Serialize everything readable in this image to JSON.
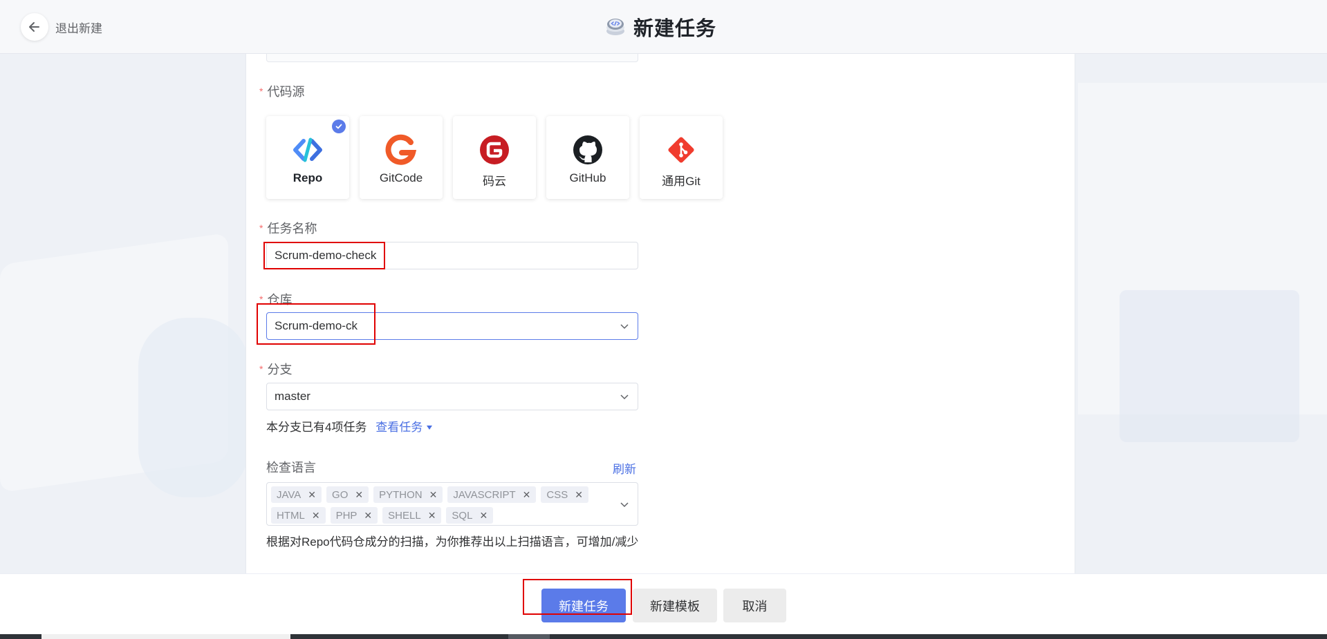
{
  "header": {
    "back_label": "退出新建",
    "title": "新建任务"
  },
  "form": {
    "source_label": "代码源",
    "sources": [
      {
        "name": "Repo",
        "icon": "repo-icon",
        "selected": true
      },
      {
        "name": "GitCode",
        "icon": "gitcode-icon",
        "selected": false
      },
      {
        "name": "码云",
        "icon": "gitee-icon",
        "selected": false
      },
      {
        "name": "GitHub",
        "icon": "github-icon",
        "selected": false
      },
      {
        "name": "通用Git",
        "icon": "git-icon",
        "selected": false
      }
    ],
    "task_name_label": "任务名称",
    "task_name_value": "Scrum-demo-check",
    "repo_label": "仓库",
    "repo_value": "Scrum-demo-ck",
    "branch_label": "分支",
    "branch_value": "master",
    "branch_hint": "本分支已有4项任务",
    "view_tasks_link": "查看任务",
    "language_label": "检查语言",
    "refresh_link": "刷新",
    "languages": [
      "JAVA",
      "GO",
      "PYTHON",
      "JAVASCRIPT",
      "CSS",
      "HTML",
      "PHP",
      "SHELL",
      "SQL"
    ],
    "language_hint": "根据对Repo代码仓成分的扫描，为你推荐出以上扫描语言，可增加/减少"
  },
  "footer": {
    "create_task": "新建任务",
    "create_template": "新建模板",
    "cancel": "取消"
  },
  "colors": {
    "primary": "#5b7be9",
    "link": "#4a6fe3",
    "required": "#f56c6c",
    "highlight": "#e00000"
  }
}
